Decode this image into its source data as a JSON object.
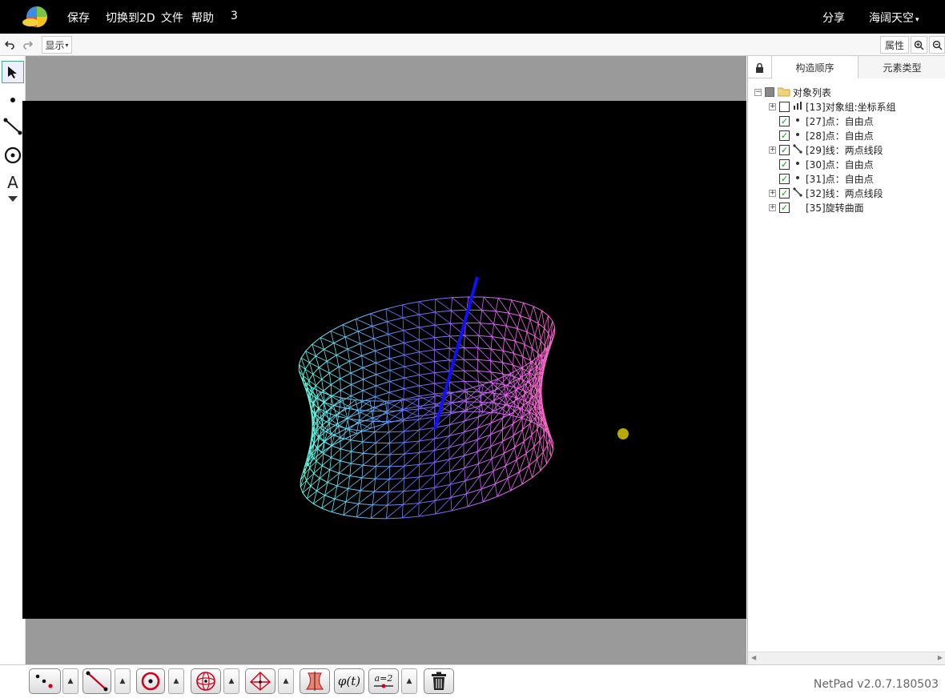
{
  "menu": {
    "save": "保存",
    "switch2d": "切换到2D",
    "file": "文件",
    "help": "帮助",
    "num": "3",
    "share": "分享",
    "user": "海阔天空"
  },
  "toolbar": {
    "undo_icon": "undo-icon",
    "redo_icon": "redo-icon",
    "display": "显示",
    "properties": "属性"
  },
  "left_tools": {
    "text_tool": "A"
  },
  "panel": {
    "tab_order": "构造顺序",
    "tab_types": "元素类型",
    "root": "对象列表",
    "items": [
      {
        "label": "[13]对象组:坐标系组",
        "checked": false,
        "icon": "chart-icon",
        "expandable": true
      },
      {
        "label": "[27]点：自由点",
        "checked": true,
        "icon": "point-icon",
        "expandable": false
      },
      {
        "label": "[28]点：自由点",
        "checked": true,
        "icon": "point-icon",
        "expandable": false
      },
      {
        "label": "[29]线：两点线段",
        "checked": true,
        "icon": "segment-icon",
        "expandable": true
      },
      {
        "label": "[30]点：自由点",
        "checked": true,
        "icon": "point-icon",
        "expandable": false
      },
      {
        "label": "[31]点：自由点",
        "checked": true,
        "icon": "point-icon",
        "expandable": false
      },
      {
        "label": "[32]线：两点线段",
        "checked": true,
        "icon": "segment-icon",
        "expandable": true
      },
      {
        "label": "[35]旋转曲面",
        "checked": true,
        "icon": "none",
        "expandable": true
      }
    ]
  },
  "bottom": {
    "phi_label": "φ(t)",
    "slider_label": "a=2",
    "version": "NetPad v2.0.7.180503"
  },
  "colors": {
    "axis": "#1010ff",
    "point": "#b8a800",
    "background": "#000000"
  }
}
